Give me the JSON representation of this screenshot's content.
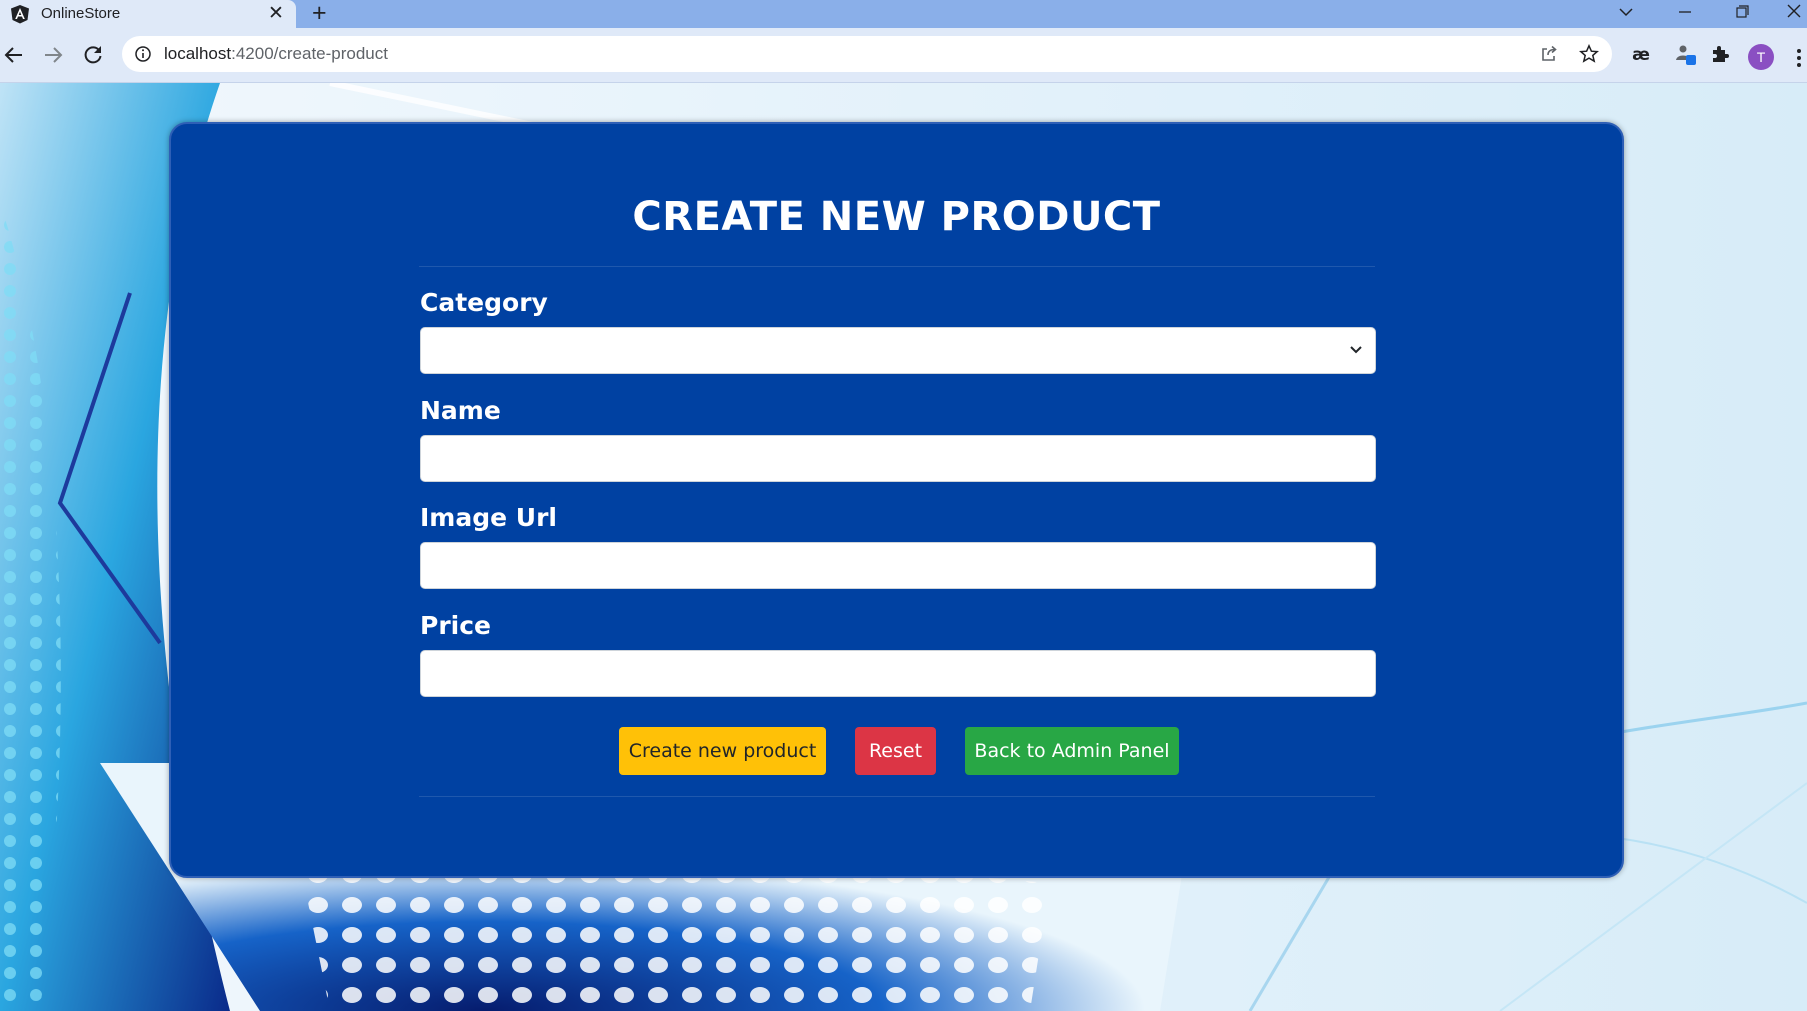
{
  "browser": {
    "tab_title": "OnlineStore",
    "url_host": "localhost",
    "url_path": ":4200/create-product",
    "profile_initial": "T"
  },
  "form": {
    "title": "CREATE NEW PRODUCT",
    "fields": [
      {
        "label": "Category",
        "type": "select",
        "value": ""
      },
      {
        "label": "Name",
        "type": "text",
        "value": ""
      },
      {
        "label": "Image Url",
        "type": "text",
        "value": ""
      },
      {
        "label": "Price",
        "type": "text",
        "value": ""
      }
    ],
    "buttons": {
      "create_label": "Create new product",
      "reset_label": "Reset",
      "back_label": "Back to Admin Panel"
    }
  },
  "colors": {
    "card": "#0041a2",
    "create_button": "#ffc107",
    "reset_button": "#dc3545",
    "back_button": "#28a745"
  }
}
